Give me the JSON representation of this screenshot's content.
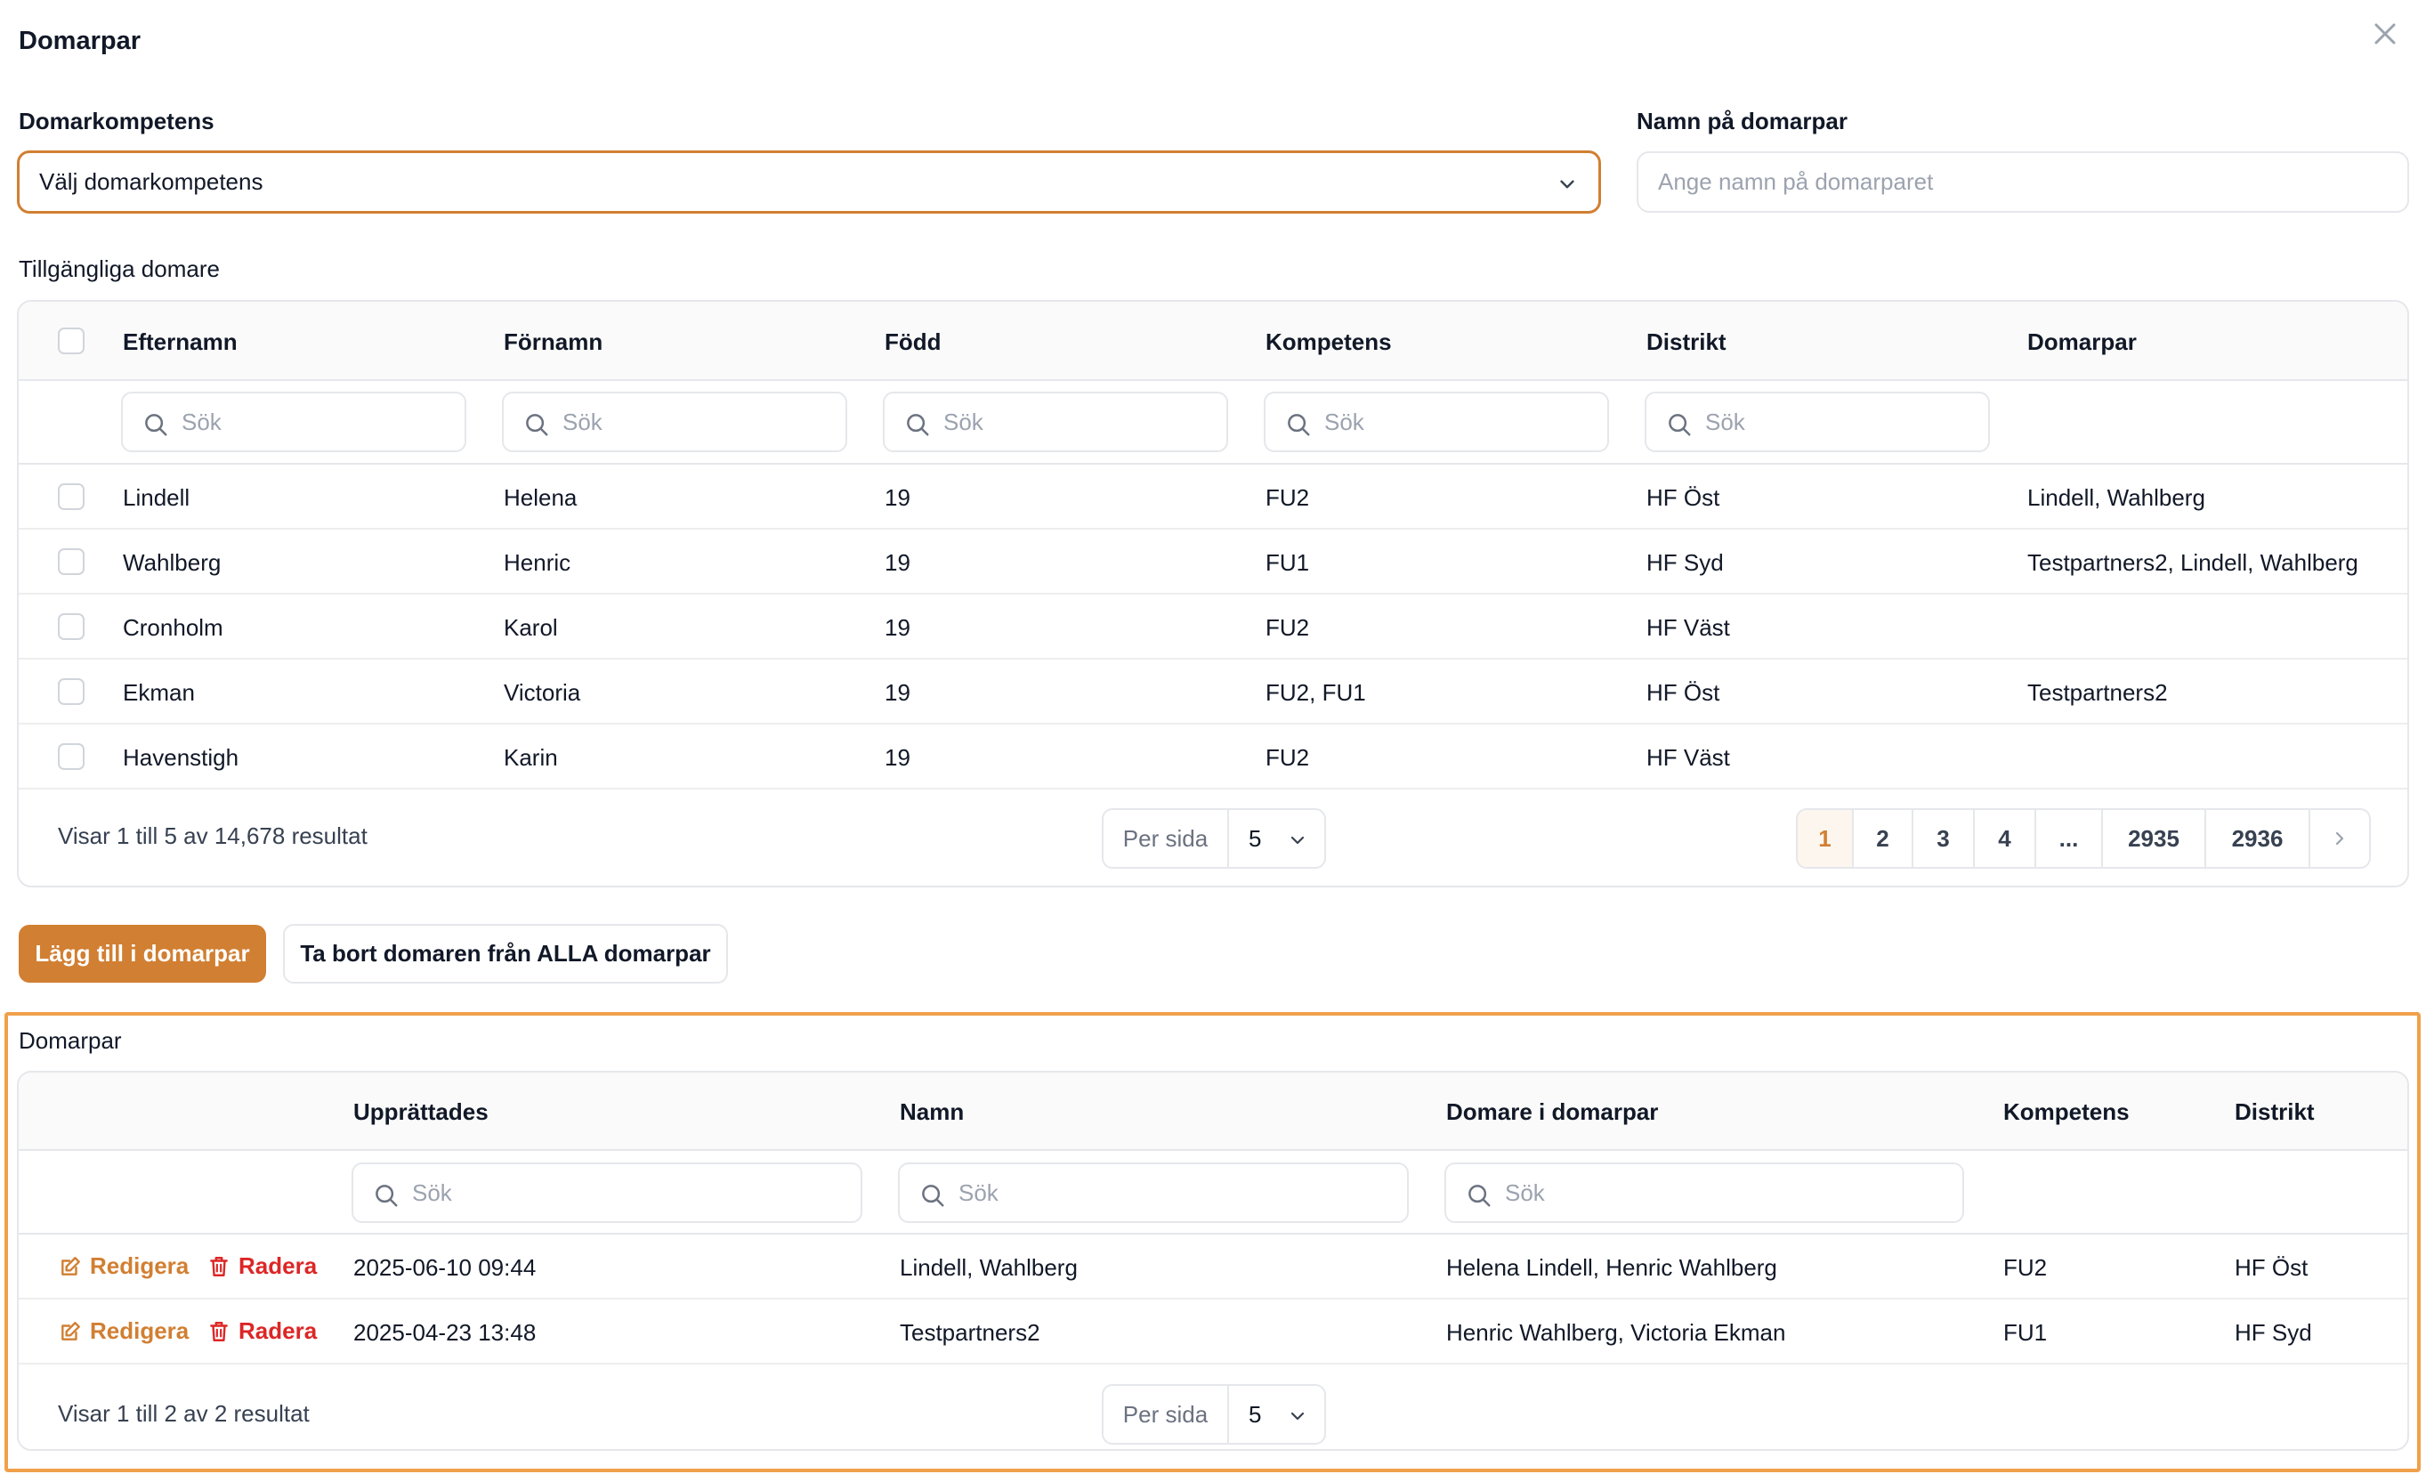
{
  "modal": {
    "title": "Domarpar"
  },
  "form": {
    "competence_label": "Domarkompetens",
    "competence_value": "Välj domarkompetens",
    "name_label": "Namn på domarpar",
    "name_placeholder": "Ange namn på domarparet"
  },
  "available": {
    "section_label": "Tillgängliga domare",
    "columns": [
      "Efternamn",
      "Förnamn",
      "Född",
      "Kompetens",
      "Distrikt",
      "Domarpar"
    ],
    "search_placeholder": "Sök",
    "rows": [
      {
        "efternamn": "Lindell",
        "fornamn": "Helena",
        "fodd": "19",
        "kompetens": "FU2",
        "distrikt": "HF Öst",
        "domarpar": "Lindell, Wahlberg"
      },
      {
        "efternamn": "Wahlberg",
        "fornamn": "Henric",
        "fodd": "19",
        "kompetens": "FU1",
        "distrikt": "HF Syd",
        "domarpar": "Testpartners2, Lindell, Wahlberg"
      },
      {
        "efternamn": "Cronholm",
        "fornamn": "Karol",
        "fodd": "19",
        "kompetens": "FU2",
        "distrikt": "HF Väst",
        "domarpar": ""
      },
      {
        "efternamn": "Ekman",
        "fornamn": "Victoria",
        "fodd": "19",
        "kompetens": "FU2, FU1",
        "distrikt": "HF Öst",
        "domarpar": "Testpartners2"
      },
      {
        "efternamn": "Havenstigh",
        "fornamn": "Karin",
        "fodd": "19",
        "kompetens": "FU2",
        "distrikt": "HF Väst",
        "domarpar": ""
      }
    ],
    "footer_text": "Visar 1 till 5 av 14,678 resultat",
    "per_page_label": "Per sida",
    "per_page_value": "5",
    "pages": [
      "1",
      "2",
      "3",
      "4",
      "...",
      "2935",
      "2936"
    ],
    "active_page": "1"
  },
  "actions": {
    "add_label": "Lägg till i domarpar",
    "remove_label": "Ta bort domaren från ALLA domarpar"
  },
  "pairs": {
    "section_label": "Domarpar",
    "columns": [
      "Upprättades",
      "Namn",
      "Domare i domarpar",
      "Kompetens",
      "Distrikt"
    ],
    "search_placeholder": "Sök",
    "edit_label": "Redigera",
    "delete_label": "Radera",
    "rows": [
      {
        "upprattades": "2025-06-10 09:44",
        "namn": "Lindell, Wahlberg",
        "domare": "Helena Lindell, Henric Wahlberg",
        "kompetens": "FU2",
        "distrikt": "HF Öst"
      },
      {
        "upprattades": "2025-04-23 13:48",
        "namn": "Testpartners2",
        "domare": "Henric Wahlberg, Victoria Ekman",
        "kompetens": "FU1",
        "distrikt": "HF Syd"
      }
    ],
    "footer_text": "Visar 1 till 2 av 2 resultat",
    "per_page_label": "Per sida",
    "per_page_value": "5"
  },
  "colors": {
    "accent": "#d17f32",
    "danger": "#dc2626",
    "highlight": "#f0a04b"
  }
}
